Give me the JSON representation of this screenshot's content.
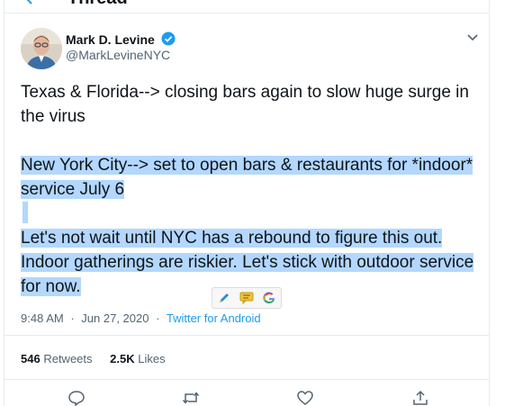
{
  "header": {
    "title": "Thread"
  },
  "tweet": {
    "author_name": "Mark D. Levine",
    "author_handle": "@MarkLevineNYC",
    "paragraph1": "Texas & Florida--> closing bars again to slow huge surge in the virus",
    "paragraph2": "New York City--> set to open bars & restaurants for *indoor* service July 6",
    "paragraph3": "Let's not wait until NYC has a rebound to figure this out. Indoor gatherings are riskier. Let's stick with outdoor service for now.",
    "time": "9:48 AM",
    "date": "Jun 27, 2020",
    "separator": "·",
    "source": "Twitter for Android"
  },
  "stats": {
    "retweets_count": "546",
    "retweets_label": "Retweets",
    "likes_count": "2.5K",
    "likes_label": "Likes"
  },
  "colors": {
    "accent": "#1d9bf0",
    "selection": "#b3d7fe",
    "muted": "#536471"
  },
  "icons": {
    "actions": [
      "reply-icon",
      "retweet-icon",
      "like-icon",
      "share-icon"
    ],
    "extension": [
      "pencil-icon",
      "comment-icon",
      "google-icon"
    ]
  }
}
